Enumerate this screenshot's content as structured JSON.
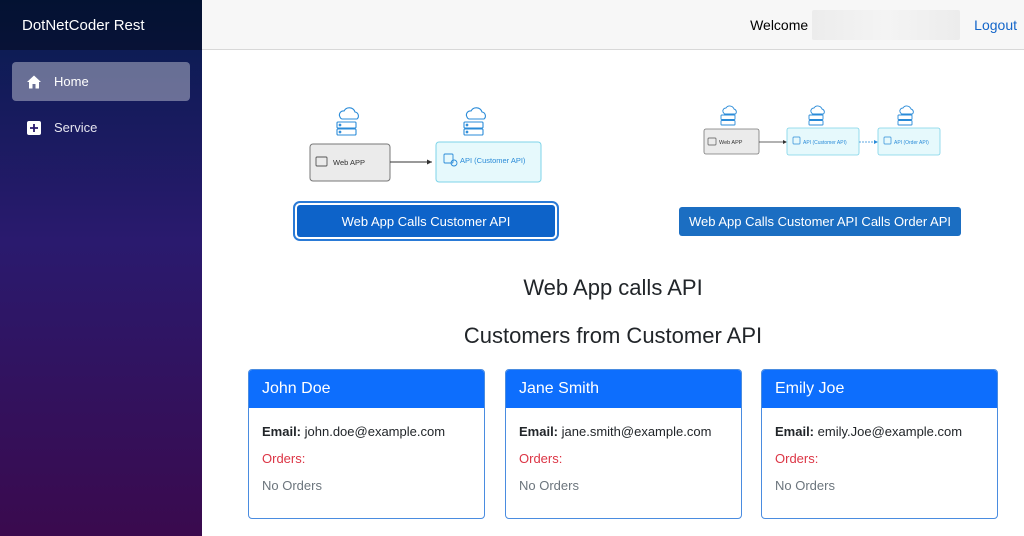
{
  "brand": "DotNetCoder Rest",
  "nav": [
    {
      "label": "Home",
      "icon": "home-icon",
      "active": true
    },
    {
      "label": "Service",
      "icon": "plus-box-icon",
      "active": false
    }
  ],
  "topbar": {
    "welcome": "Welcome",
    "logout": "Logout"
  },
  "diagram1": {
    "web_app": "Web APP",
    "api": "API (Customer API)"
  },
  "diagram2": {
    "web_app": "Web APP",
    "api1": "API (Customer API)",
    "api2": "API (Order API)"
  },
  "buttons": {
    "btn1": "Web App Calls Customer API",
    "btn2": "Web App Calls Customer API Calls Order API"
  },
  "headings": {
    "h1": "Web App calls API",
    "h2": "Customers from Customer API"
  },
  "customers": [
    {
      "name": "John Doe",
      "email_label": "Email:",
      "email": "john.doe@example.com",
      "orders_label": "Orders:",
      "orders": "No Orders"
    },
    {
      "name": "Jane Smith",
      "email_label": "Email:",
      "email": "jane.smith@example.com",
      "orders_label": "Orders:",
      "orders": "No Orders"
    },
    {
      "name": "Emily Joe",
      "email_label": "Email:",
      "email": "emily.Joe@example.com",
      "orders_label": "Orders:",
      "orders": "No Orders"
    }
  ],
  "colors": {
    "accent": "#1b6ec2",
    "card_header": "#0d6efd",
    "orders": "#dc3545"
  }
}
